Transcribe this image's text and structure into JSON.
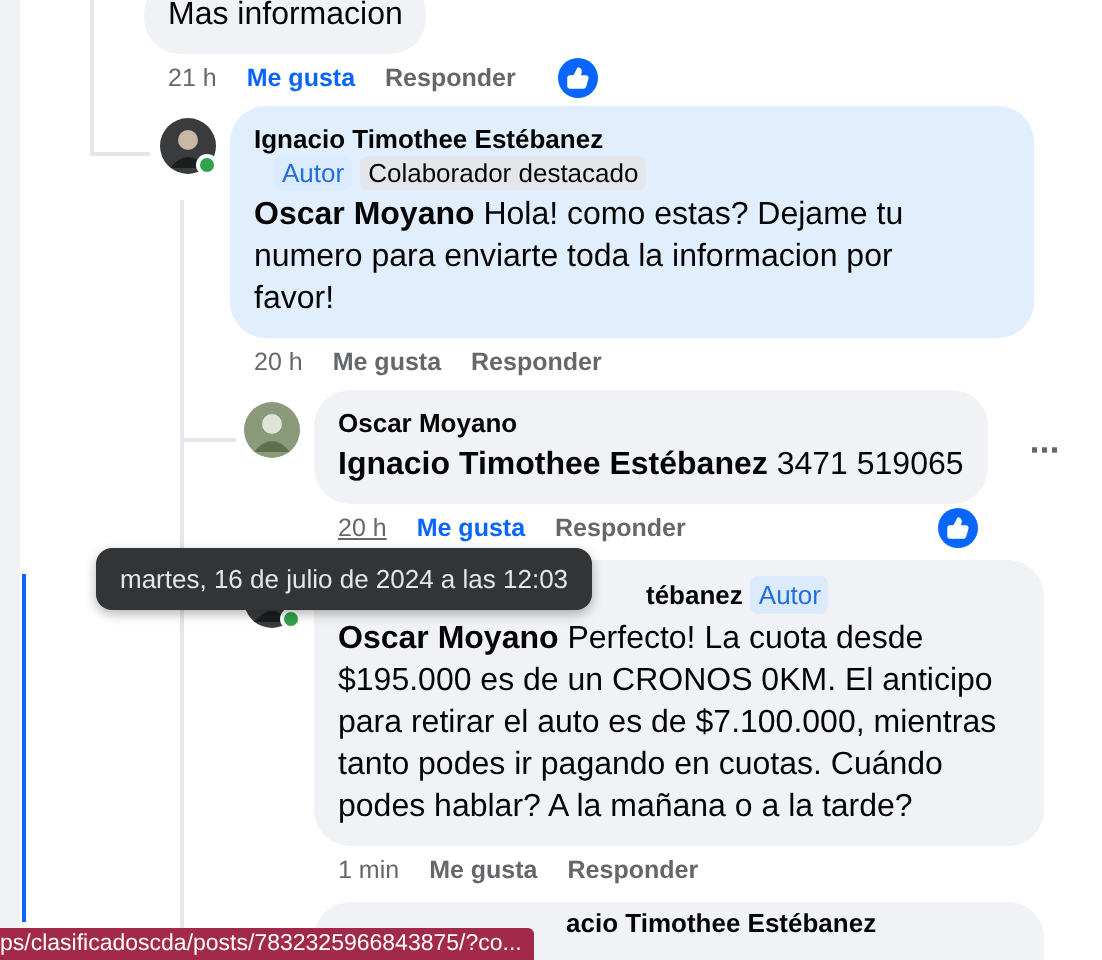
{
  "comments": [
    {
      "kind": "comment",
      "text": "Mas informacion",
      "time": "21 h",
      "like_label": "Me gusta",
      "reply_label": "Responder",
      "liked": true,
      "reaction": true,
      "children": [
        {
          "kind": "comment",
          "author": "Ignacio Timothee Estébanez",
          "online": true,
          "highlighted": true,
          "badges": [
            {
              "label": "Autor",
              "kind": "author"
            },
            {
              "label": "Colaborador destacado",
              "kind": "contributor"
            }
          ],
          "mention": "Oscar Moyano",
          "text": "Hola! como estas? Dejame tu numero para enviarte toda la informacion por favor!",
          "time": "20 h",
          "like_label": "Me gusta",
          "reply_label": "Responder",
          "liked": false,
          "reaction": false,
          "children": [
            {
              "kind": "comment",
              "author": "Oscar Moyano",
              "online": false,
              "highlighted": false,
              "mention": "Ignacio Timothee Estébanez",
              "text": "3471 519065",
              "time": "20 h",
              "time_hovered": true,
              "like_label": "Me gusta",
              "reply_label": "Responder",
              "liked": true,
              "reaction": true,
              "more_menu": true,
              "more_label": "···"
            },
            {
              "kind": "comment",
              "author": "tébanez",
              "covered": true,
              "online": true,
              "highlighted": false,
              "badges": [
                {
                  "label": "Autor",
                  "kind": "author"
                }
              ],
              "mention": "Oscar Moyano",
              "text": "Perfecto! La cuota desde $195.000 es de un CRONOS 0KM. El anticipo para retirar el auto es de $7.100.000, mientras tanto podes ir pagando en cuotas. Cuándo podes hablar? A la mañana o a la tarde?",
              "time": "1 min",
              "like_label": "Me gusta",
              "reply_label": "Responder",
              "liked": false,
              "reaction": false
            },
            {
              "kind": "partial",
              "author": "acio Timothee Estébanez"
            }
          ]
        }
      ]
    }
  ],
  "tooltip": "martes, 16 de julio de 2024 a las 12:03",
  "status_url": "ps/clasificadoscda/posts/7832325966843875/?co..."
}
